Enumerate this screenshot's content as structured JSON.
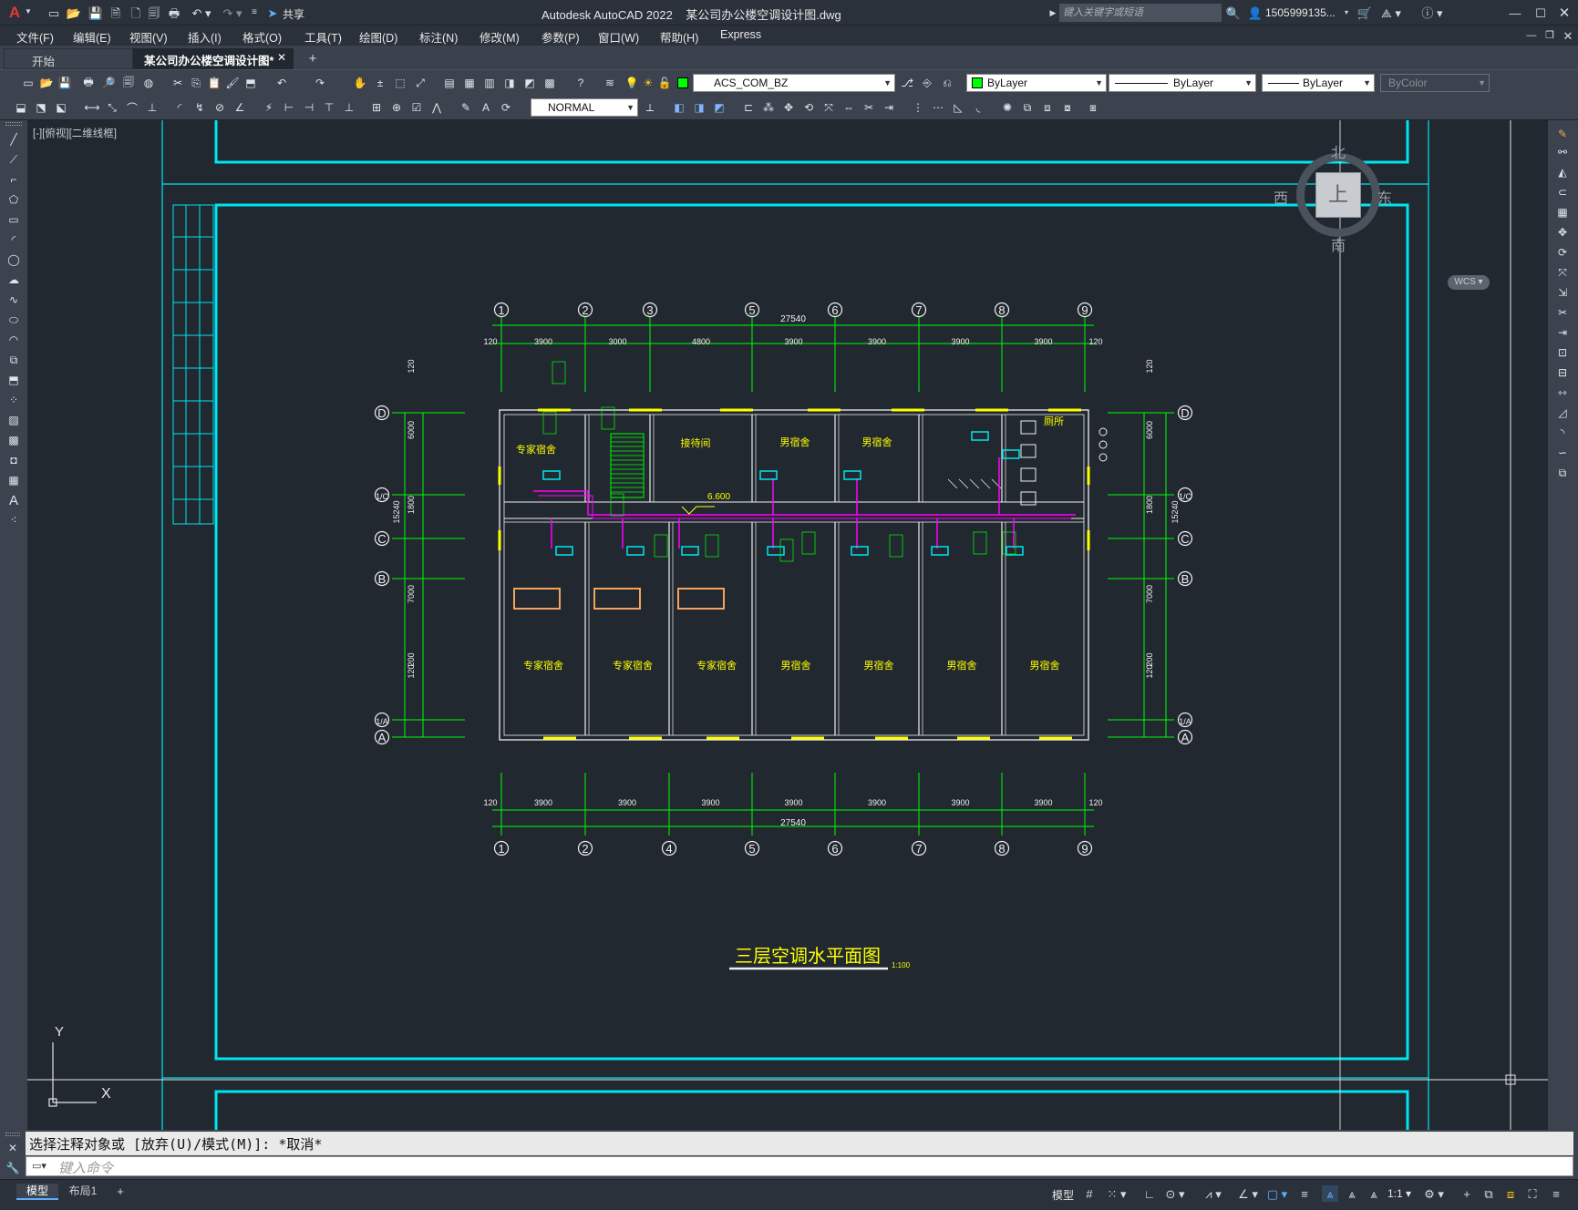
{
  "titlebar": {
    "app_logo": "A",
    "share_label": "共享",
    "title": "Autodesk AutoCAD 2022    某公司办公楼空调设计图.dwg",
    "search_placeholder": "键入关键字或短语",
    "user": "1505999135..."
  },
  "menus": [
    "文件(F)",
    "编辑(E)",
    "视图(V)",
    "插入(I)",
    "格式(O)",
    "工具(T)",
    "绘图(D)",
    "标注(N)",
    "修改(M)",
    "参数(P)",
    "窗口(W)",
    "帮助(H)",
    "Express"
  ],
  "tabs": {
    "start": "开始",
    "doc": "某公司办公楼空调设计图*"
  },
  "toolbar": {
    "layer": "ACS_COM_BZ",
    "color": "ByLayer",
    "linetype": "ByLayer",
    "lineweight": "ByLayer",
    "plotstyle": "ByColor",
    "dimstyle": "NORMAL"
  },
  "viewport_label": "[-][俯视][二维线框]",
  "viewcube": {
    "north": "北",
    "south": "南",
    "east": "东",
    "west": "西",
    "top": "上",
    "wcs": "WCS"
  },
  "drawing": {
    "title": "三层空调水平面图",
    "scale": "1:100",
    "axis_cols_top": [
      "1",
      "2",
      "3",
      "5",
      "6",
      "7",
      "8",
      "9"
    ],
    "axis_cols_bottom": [
      "1",
      "2",
      "4",
      "5",
      "6",
      "7",
      "8",
      "9"
    ],
    "axis_rows": [
      "D",
      "1/C",
      "C",
      "B",
      "1/A",
      "A"
    ],
    "top_dims": [
      "120",
      "3900",
      "3000",
      "4800",
      "3900",
      "3900",
      "3900",
      "3900",
      "120"
    ],
    "bottom_dims": [
      "120",
      "3900",
      "3900",
      "3900",
      "3900",
      "3900",
      "3900",
      "3900",
      "120"
    ],
    "total_width": "27540",
    "side_dims": [
      "120",
      "6000",
      "1800",
      "7000",
      "200",
      "120"
    ],
    "side_total": "15240",
    "elevation": "6.600",
    "rooms": {
      "expert_top": "专家宿舍",
      "office": "接待间",
      "male": "男宿舍",
      "toilet": "厕所",
      "expert": "专家宿舍"
    }
  },
  "ucs": {
    "x": "X",
    "y": "Y"
  },
  "command": {
    "history": "选择注释对象或 [放弃(U)/模式(M)]: *取消*",
    "placeholder": "键入命令"
  },
  "status": {
    "tab_model": "模型",
    "tab_layout": "布局1",
    "model_btn": "模型",
    "scale": "1:1"
  }
}
